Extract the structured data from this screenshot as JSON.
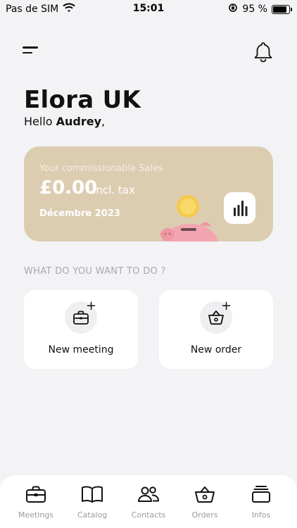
{
  "status_bar": {
    "carrier": "Pas de SIM",
    "time": "15:01",
    "battery_percent": "95 %",
    "battery_level": 0.95
  },
  "header": {
    "menu_icon": "hamburger-menu-icon",
    "notification_icon": "bell-icon"
  },
  "company": {
    "name": "Elora UK"
  },
  "greeting": {
    "prefix": "Hello ",
    "name": "Audrey",
    "suffix": ","
  },
  "sales_card": {
    "label": "Your commissionable Sales",
    "amount": "£0.00",
    "tax_note": "Incl. tax",
    "period": "Décembre 2023",
    "background": "#dccdb1",
    "chart_button_icon": "bar-chart-icon"
  },
  "actions": {
    "section_title": "WHAT DO YOU WANT TO DO ?",
    "items": [
      {
        "label": "New meeting",
        "icon": "briefcase-plus-icon"
      },
      {
        "label": "New order",
        "icon": "basket-plus-icon"
      }
    ]
  },
  "tab_bar": {
    "items": [
      {
        "label": "Meetings",
        "icon": "briefcase-icon",
        "active": true
      },
      {
        "label": "Catalog",
        "icon": "book-icon"
      },
      {
        "label": "Contacts",
        "icon": "contacts-icon"
      },
      {
        "label": "Orders",
        "icon": "basket-icon"
      },
      {
        "label": "Infos",
        "icon": "stack-icon"
      }
    ]
  }
}
